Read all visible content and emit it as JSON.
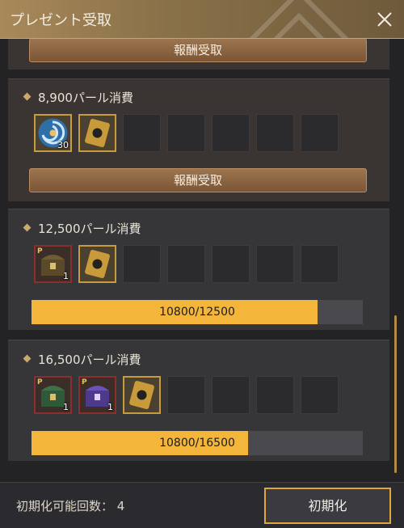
{
  "window": {
    "title": "プレゼント受取"
  },
  "rewards": [
    {
      "cost_label": "",
      "claim_label": "報酬受取"
    },
    {
      "cost_label": "8,900パール消費",
      "claim_label": "報酬受取",
      "items": [
        {
          "icon": "blue-swirl-orb-icon",
          "qty": "30"
        },
        {
          "icon": "gold-ticket-icon",
          "qty": ""
        }
      ]
    },
    {
      "cost_label": "12,500パール消費",
      "progress_text": "10800/12500",
      "progress": 0.864,
      "items": [
        {
          "icon": "treasure-chest-icon",
          "badge": "P",
          "qty": "1"
        },
        {
          "icon": "gold-ticket-icon",
          "qty": ""
        }
      ]
    },
    {
      "cost_label": "16,500パール消費",
      "progress_text": "10800/16500",
      "progress": 0.6545,
      "items": [
        {
          "icon": "green-chest-icon",
          "badge": "P",
          "qty": "1"
        },
        {
          "icon": "purple-chest-icon",
          "badge": "P",
          "qty": "1"
        },
        {
          "icon": "gold-ticket-icon",
          "qty": ""
        }
      ]
    }
  ],
  "footer": {
    "reset_count_label": "初期化可能回数： 4",
    "reset_button": "初期化"
  },
  "colors": {
    "accent": "#f3b53a",
    "title_bar": "#8a7149",
    "claim_button": "#8a6242"
  }
}
